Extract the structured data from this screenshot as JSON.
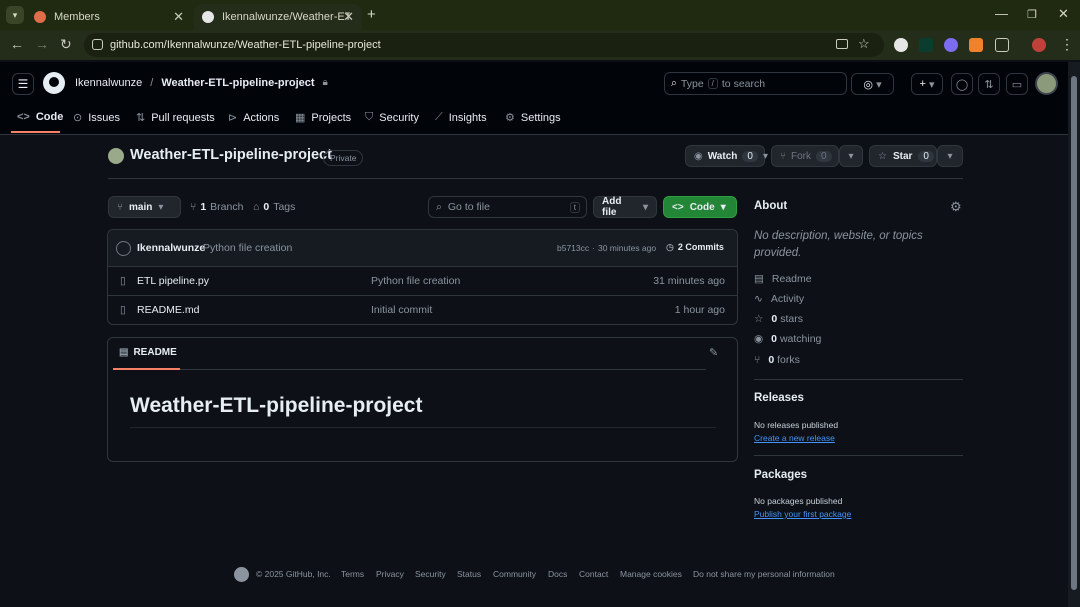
{
  "browser": {
    "tabs": [
      {
        "title": "Members",
        "active": false
      },
      {
        "title": "Ikennalwunze/Weather-ETL-pip",
        "active": true
      }
    ],
    "url": "github.com/Ikennalwunze/Weather-ETL-pipeline-project"
  },
  "header": {
    "owner": "Ikennalwunze",
    "separator": "/",
    "repo": "Weather-ETL-pipeline-project",
    "search_prefix": "Type",
    "search_key": "/",
    "search_suffix": "to search"
  },
  "repo_nav": [
    {
      "label": "Code",
      "icon": "code-icon",
      "active": true
    },
    {
      "label": "Issues",
      "icon": "issue-icon"
    },
    {
      "label": "Pull requests",
      "icon": "pull-request-icon"
    },
    {
      "label": "Actions",
      "icon": "play-icon"
    },
    {
      "label": "Projects",
      "icon": "table-icon"
    },
    {
      "label": "Security",
      "icon": "shield-icon"
    },
    {
      "label": "Insights",
      "icon": "graph-icon"
    },
    {
      "label": "Settings",
      "icon": "gear-icon"
    }
  ],
  "title": {
    "name": "Weather-ETL-pipeline-project",
    "visibility": "Private",
    "watch_label": "Watch",
    "watch_count": "0",
    "fork_label": "Fork",
    "fork_count": "0",
    "star_label": "Star",
    "star_count": "0"
  },
  "toolbar": {
    "branch": "main",
    "branch_count": "1",
    "branch_label": "Branch",
    "tag_count": "0",
    "tag_label": "Tags",
    "goto_placeholder": "Go to file",
    "goto_key": "t",
    "add_file": "Add file",
    "code": "Code"
  },
  "commit": {
    "author": "Ikennalwunze",
    "message": "Python file creation",
    "hash": "b5713cc",
    "dot": "·",
    "time": "30 minutes ago",
    "count": "2 Commits"
  },
  "files": [
    {
      "name": "ETL pipeline.py",
      "message": "Python file creation",
      "time": "31 minutes ago"
    },
    {
      "name": "README.md",
      "message": "Initial commit",
      "time": "1 hour ago"
    }
  ],
  "readme": {
    "tab": "README",
    "heading": "Weather-ETL-pipeline-project"
  },
  "about": {
    "title": "About",
    "description": "No description, website, or topics provided.",
    "readme": "Readme",
    "activity": "Activity",
    "stars_count": "0",
    "stars_label": "stars",
    "watching_count": "0",
    "watching_label": "watching",
    "forks_count": "0",
    "forks_label": "forks"
  },
  "releases": {
    "title": "Releases",
    "empty": "No releases published",
    "link": "Create a new release"
  },
  "packages": {
    "title": "Packages",
    "empty": "No packages published",
    "link": "Publish your first package"
  },
  "footer": {
    "copyright": "© 2025 GitHub, Inc.",
    "links": [
      "Terms",
      "Privacy",
      "Security",
      "Status",
      "Community",
      "Docs",
      "Contact",
      "Manage cookies",
      "Do not share my personal information"
    ]
  },
  "colors": {
    "accent_underline": "#f78166",
    "code_button": "#238636",
    "link": "#4493f8"
  }
}
